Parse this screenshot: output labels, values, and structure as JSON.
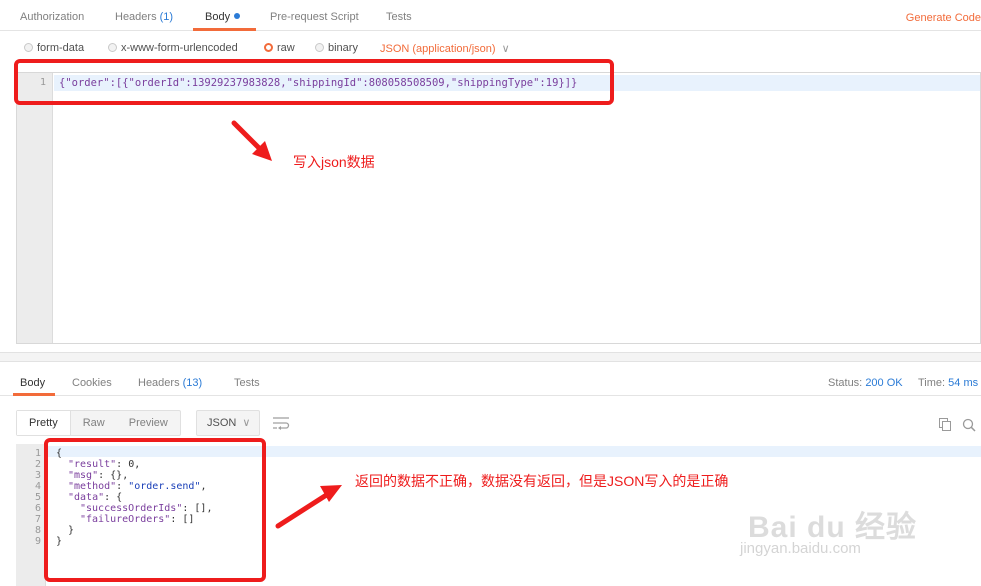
{
  "request_tabs": {
    "authorization": "Authorization",
    "headers": "Headers",
    "headers_count": "(1)",
    "body": "Body",
    "prerequest": "Pre-request Script",
    "tests": "Tests",
    "generate_code": "Generate Code"
  },
  "body_options": {
    "form_data": "form-data",
    "urlencoded": "x-www-form-urlencoded",
    "raw": "raw",
    "binary": "binary",
    "content_type": "JSON (application/json)",
    "selected": "raw"
  },
  "request_editor": {
    "line_number": "1",
    "line": "{\"order\":[{\"orderId\":13929237983828,\"shippingId\":808058508509,\"shippingType\":19}]}"
  },
  "annotations": {
    "request_note": "写入json数据",
    "response_note": "返回的数据不正确，数据没有返回，但是JSON写入的是正确"
  },
  "response_tabs": {
    "body": "Body",
    "cookies": "Cookies",
    "headers": "Headers",
    "headers_count": "(13)",
    "tests": "Tests",
    "status_label": "Status:",
    "status_value": "200 OK",
    "time_label": "Time:",
    "time_value": "54 ms"
  },
  "response_toolbar": {
    "pretty": "Pretty",
    "raw": "Raw",
    "preview": "Preview",
    "format": "JSON"
  },
  "response_body": {
    "line_numbers": [
      "1",
      "2",
      "3",
      "4",
      "5",
      "6",
      "7",
      "8",
      "9"
    ],
    "l1": "{",
    "l2_key": "\"result\"",
    "l2_val": " 0,",
    "l3_key": "\"msg\"",
    "l3_val": " {},",
    "l4_key": "\"method\"",
    "l4_val": "\"order.send\"",
    "l5_key": "\"data\"",
    "l5_val": " {",
    "l6_key": "\"successOrderIds\"",
    "l6_val": " [],",
    "l7_key": "\"failureOrders\"",
    "l7_val": " []",
    "l8": "}",
    "l9": "}"
  },
  "watermark": {
    "brand": "Bai du 经验",
    "url": "jingyan.baidu.com"
  }
}
